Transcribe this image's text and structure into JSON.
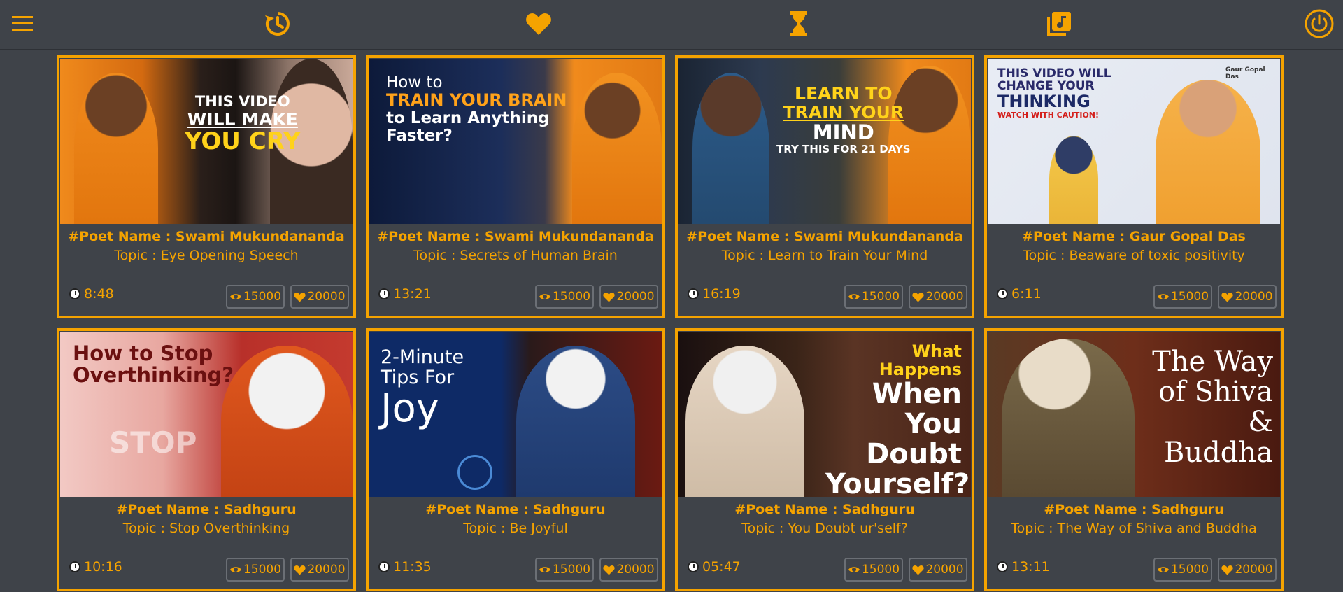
{
  "colors": {
    "accent": "#f5a300",
    "background": "#3f4349"
  },
  "nav": {
    "menu_icon": "hamburger-menu-icon",
    "items": [
      {
        "name": "history-icon"
      },
      {
        "name": "heart-icon"
      },
      {
        "name": "hourglass-icon"
      },
      {
        "name": "music-library-icon"
      }
    ],
    "power_icon": "power-icon"
  },
  "cards": [
    {
      "poet": "#Poet Name : Swami Mukundananda",
      "topic": "Topic : Eye Opening Speech",
      "duration": "8:48",
      "views": "15000",
      "likes": "20000",
      "thumb_text": [
        "THIS VIDEO",
        "WILL MAKE",
        "YOU CRY"
      ]
    },
    {
      "poet": "#Poet Name : Swami Mukundananda",
      "topic": "Topic : Secrets of Human Brain",
      "duration": "13:21",
      "views": "15000",
      "likes": "20000",
      "thumb_text": [
        "How to",
        "TRAIN YOUR BRAIN",
        "to Learn Anything",
        "Faster?"
      ]
    },
    {
      "poet": "#Poet Name : Swami Mukundananda",
      "topic": "Topic : Learn to Train Your Mind",
      "duration": "16:19",
      "views": "15000",
      "likes": "20000",
      "thumb_text": [
        "LEARN TO",
        "TRAIN YOUR",
        "MIND",
        "TRY THIS FOR 21 DAYS"
      ]
    },
    {
      "poet": "#Poet Name : Gaur Gopal Das",
      "topic": "Topic : Beaware of toxic positivity",
      "duration": "6:11",
      "views": "15000",
      "likes": "20000",
      "thumb_text": [
        "THIS VIDEO WILL",
        "CHANGE YOUR",
        "THINKING",
        "WATCH WITH CAUTION!",
        "Gaur Gopal Das"
      ]
    },
    {
      "poet": "#Poet Name : Sadhguru",
      "topic": "Topic : Stop Overthinking",
      "duration": "10:16",
      "views": "15000",
      "likes": "20000",
      "thumb_text": [
        "How to Stop",
        "Overthinking?",
        "STOP"
      ]
    },
    {
      "poet": "#Poet Name : Sadhguru",
      "topic": "Topic : Be Joyful",
      "duration": "11:35",
      "views": "15000",
      "likes": "20000",
      "thumb_text": [
        "2-Minute",
        "Tips For",
        "Joy"
      ]
    },
    {
      "poet": "#Poet Name : Sadhguru",
      "topic": "Topic : You Doubt ur'self?",
      "duration": "05:47",
      "views": "15000",
      "likes": "20000",
      "thumb_text": [
        "What Happens",
        "When You",
        "Doubt",
        "Yourself?"
      ]
    },
    {
      "poet": "#Poet Name : Sadhguru",
      "topic": "Topic : The Way of Shiva and Buddha",
      "duration": "13:11",
      "views": "15000",
      "likes": "20000",
      "thumb_text": [
        "The Way",
        "of Shiva &",
        "Buddha"
      ]
    }
  ]
}
